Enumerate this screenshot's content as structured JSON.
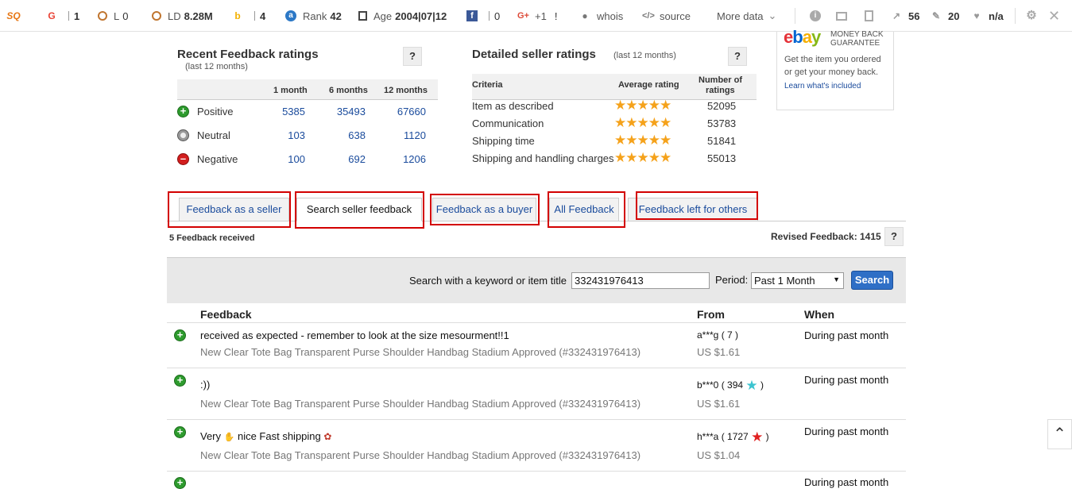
{
  "toolbar": {
    "google": {
      "label": "G",
      "value": "1"
    },
    "links": {
      "label": "L",
      "value": "0"
    },
    "linking_domains": {
      "label": "LD",
      "value": "8.28M"
    },
    "bing": {
      "label": "b",
      "value": "4"
    },
    "rank": {
      "label": "Rank",
      "value": "42"
    },
    "age": {
      "label": "Age",
      "value": "2004|07|12"
    },
    "facebook": {
      "value": "0"
    },
    "gplus": {
      "label": "+1",
      "value": "!"
    },
    "whois": "whois",
    "source": "source",
    "more_data": "More data",
    "count_a": "56",
    "count_b": "20",
    "health": "n/a"
  },
  "recent_ratings": {
    "title": "Recent Feedback ratings",
    "subtitle": "(last 12 months)",
    "help": "?",
    "columns": [
      "1 month",
      "6 months",
      "12 months"
    ],
    "rows": [
      {
        "label": "Positive",
        "values": [
          "5385",
          "35493",
          "67660"
        ]
      },
      {
        "label": "Neutral",
        "values": [
          "103",
          "638",
          "1120"
        ]
      },
      {
        "label": "Negative",
        "values": [
          "100",
          "692",
          "1206"
        ]
      }
    ]
  },
  "detailed_ratings": {
    "title": "Detailed seller ratings",
    "subtitle": "(last 12 months)",
    "help": "?",
    "col_criteria": "Criteria",
    "col_avg": "Average rating",
    "col_num_line1": "Number of",
    "col_num_line2": "ratings",
    "rows": [
      {
        "criteria": "Item as described",
        "stars": 4.8,
        "count": "52095"
      },
      {
        "criteria": "Communication",
        "stars": 4.9,
        "count": "53783"
      },
      {
        "criteria": "Shipping time",
        "stars": 4.8,
        "count": "51841"
      },
      {
        "criteria": "Shipping and handling charges",
        "stars": 4.9,
        "count": "55013"
      }
    ]
  },
  "guarantee": {
    "logo": "ebay",
    "badge_line1": "MONEY BACK",
    "badge_line2": "GUARANTEE",
    "text_line1": "Get the item you ordered",
    "text_line2": "or get your money back.",
    "link": "Learn what's included"
  },
  "tabs": [
    {
      "label": "Feedback as a seller"
    },
    {
      "label": "Search seller feedback"
    },
    {
      "label": "Feedback as a buyer"
    },
    {
      "label": "All Feedback"
    },
    {
      "label": "Feedback left for others"
    }
  ],
  "summary": {
    "received": "5 Feedback received",
    "revised_label": "Revised Feedback:",
    "revised_value": "1415",
    "help": "?"
  },
  "search": {
    "label": "Search with a keyword or item title",
    "value": "332431976413",
    "period_label": "Period:",
    "period_value": "Past 1 Month",
    "button": "Search"
  },
  "table": {
    "headers": {
      "feedback": "Feedback",
      "from": "From",
      "when": "When"
    },
    "rows": [
      {
        "type": "positive",
        "text": "received as expected - remember to look at the size mesourment!!1",
        "item": "New Clear Tote Bag Transparent Purse Shoulder Handbag Stadium Approved (#332431976413)",
        "from": "a***g ( 7 )",
        "price": "US $1.61",
        "when": "During past month"
      },
      {
        "type": "positive",
        "text": ":))",
        "item": "New Clear Tote Bag Transparent Purse Shoulder Handbag Stadium Approved (#332431976413)",
        "from_user": "b***0",
        "from_score": "394",
        "from_star": "turquoise-star-icon",
        "price": "US $1.61",
        "when": "During past month"
      },
      {
        "type": "positive",
        "text_a": "Very",
        "text_b": "nice Fast shipping",
        "item": "New Clear Tote Bag Transparent Purse Shoulder Handbag Stadium Approved (#332431976413)",
        "from_user": "h***a",
        "from_score": "1727",
        "from_star": "red-star-icon",
        "price": "US $1.04",
        "when": "During past month"
      },
      {
        "type": "positive",
        "when": "During past month"
      }
    ]
  },
  "colors": {
    "link": "#1a4b9c",
    "highlight_box": "#d30000",
    "search_button": "#2f6fc6",
    "stars": "#f5a21b"
  }
}
